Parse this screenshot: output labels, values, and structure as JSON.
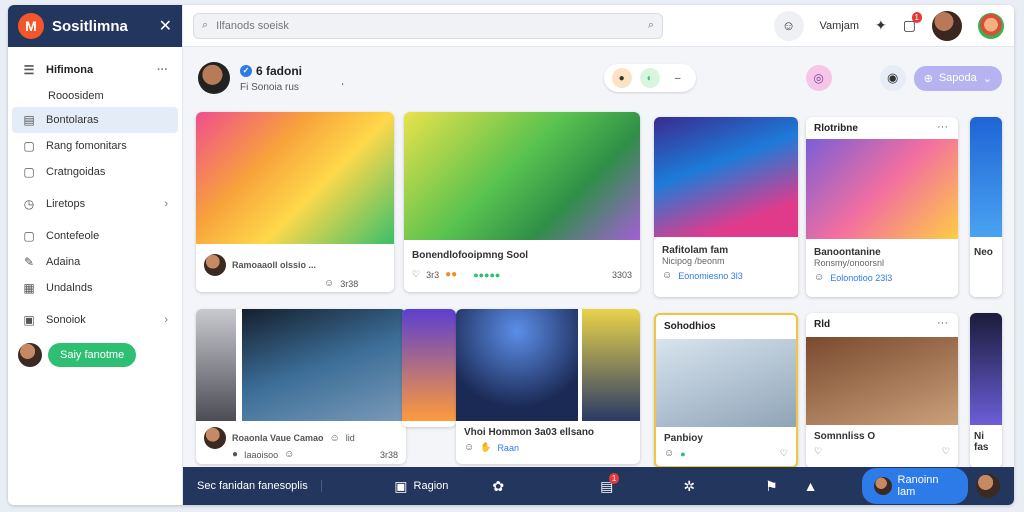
{
  "brand": {
    "name": "Sositlimna",
    "logo": "M"
  },
  "sidebar": {
    "header": "Hifimona",
    "items": [
      {
        "label": "Rooosidem",
        "icon": "",
        "sub": true
      },
      {
        "label": "Bontolaras",
        "icon": "list-icon",
        "active": true
      },
      {
        "label": "Rang fomonitars",
        "icon": "document-icon"
      },
      {
        "label": "Cratngoidas",
        "icon": "document-icon"
      },
      {
        "label": "Liretops",
        "icon": "clock-icon",
        "trail": "›"
      },
      {
        "label": "Contefeole",
        "icon": "square-icon"
      },
      {
        "label": "Adaina",
        "icon": "doc-edit-icon"
      },
      {
        "label": "Undalnds",
        "icon": "grid-icon"
      },
      {
        "label": "Sonoiok",
        "icon": "clipboard-icon",
        "trail": "›"
      }
    ],
    "cta": "Saiy fanotme"
  },
  "search": {
    "placeholder": "Ilfanods soeisk"
  },
  "topbar": {
    "user_label": "Vamjam",
    "notif_count": "1"
  },
  "subhead": {
    "title": "6 fadoni",
    "subtitle": "Fi Sonoia rus",
    "cursor": "'",
    "pill_minus": "–",
    "button": "Sapoda"
  },
  "cards": [
    {
      "title": "Ramoaaoll olssio ..."
    },
    {
      "title": "Bonendlofooipmng Sool",
      "count": "3303"
    },
    {
      "title": "Rafitolam fam",
      "sub": "Nicipog /beonm",
      "foot": "Eonomiesno 3l3"
    },
    {
      "head": "Rlotribne",
      "title": "Banoontanine",
      "sub": "Ronsmy/onoorsnl",
      "foot": "Eolonotioo 23l3"
    },
    {
      "title": "Roaonla Vaue Camao",
      "count": "lid",
      "foot": "Iaaoisoo"
    },
    {
      "title": "Vhoi Hommon 3a03 ellsano",
      "foot": "Raan"
    },
    {
      "head": "Sohodhios",
      "title": "Panbioy"
    },
    {
      "head": "Rld",
      "title": "Somnnliss O"
    },
    {
      "title": "Neo",
      "foot": "Ni fas"
    }
  ],
  "card_values": {
    "c1_count": "3r38",
    "c2_count": "3r3",
    "c2_extra": "3303",
    "c5_count": "3r38"
  },
  "bottombar": {
    "left": "Sec fanidan fanesoplis",
    "middle": "Ragion",
    "notif": "1",
    "button": "Ranoinn lam"
  },
  "colors": {
    "navy": "#23365e",
    "accent_green": "#2fbf72",
    "accent_blue": "#2d7be8",
    "brand_orange": "#f2562a"
  }
}
